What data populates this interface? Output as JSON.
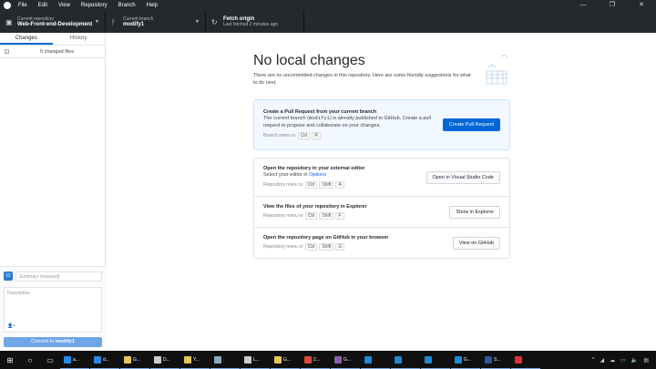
{
  "menu": [
    "File",
    "Edit",
    "View",
    "Repository",
    "Branch",
    "Help"
  ],
  "window_controls": [
    "—",
    "❐",
    "✕"
  ],
  "toolbar": {
    "repo_label": "Current repository",
    "repo": "Web-Front-end-Development",
    "branch_label": "Current branch",
    "branch": "modify1",
    "fetch": "Fetch origin",
    "fetched": "Last fetched 2 minutes ago"
  },
  "sidebar": {
    "tabs": [
      "Changes",
      "History"
    ],
    "changed": "0 changed files",
    "summary_placeholder": "Summary (required)",
    "description_placeholder": "Description",
    "commit_prefix": "Commit to ",
    "commit_branch": "modify1"
  },
  "main": {
    "title": "No local changes",
    "intro": "There are no uncommitted changes in this repository. Here are some friendly suggestions for what to do next.",
    "pr": {
      "title": "Create a Pull Request from your current branch",
      "desc_a": "The current branch (",
      "branch": "modify1",
      "desc_b": ") is already published to GitHub. Create a pull request to propose and collaborate on your changes.",
      "hint": "Branch menu or",
      "keys": [
        "Ctrl",
        "R"
      ],
      "button": "Create Pull Request"
    },
    "cards": [
      {
        "title": "Open the repository in your external editor",
        "desc": "Select your editor in ",
        "link": "Options",
        "hint": "Repository menu or",
        "keys": [
          "Ctrl",
          "Shift",
          "A"
        ],
        "button": "Open in Visual Studio Code"
      },
      {
        "title": "View the files of your repository in Explorer",
        "hint": "Repository menu or",
        "keys": [
          "Ctrl",
          "Shift",
          "F"
        ],
        "button": "Show in Explorer"
      },
      {
        "title": "Open the repository page on GitHub in your browser",
        "hint": "Repository menu or",
        "keys": [
          "Ctrl",
          "Shift",
          "G"
        ],
        "button": "View on GitHub"
      }
    ]
  },
  "taskbar": {
    "items": [
      {
        "label": "a...",
        "color": "#2b8ae6"
      },
      {
        "label": "d...",
        "color": "#2b8ae6"
      },
      {
        "label": "G...",
        "color": "#e8c25a"
      },
      {
        "label": "D...",
        "color": "#ccc"
      },
      {
        "label": "Y...",
        "color": "#e8c25a"
      },
      {
        "label": "",
        "color": "#8ab"
      },
      {
        "label": "L...",
        "color": "#ccc"
      },
      {
        "label": "G...",
        "color": "#e8c25a"
      },
      {
        "label": "2...",
        "color": "#e04a3a"
      },
      {
        "label": "G...",
        "color": "#8e5ea2"
      },
      {
        "label": "",
        "color": "#1e8ad6"
      },
      {
        "label": "",
        "color": "#1e8ad6"
      },
      {
        "label": "",
        "color": "#1e8ad6"
      },
      {
        "label": "G...",
        "color": "#1e8ad6"
      },
      {
        "label": "S...",
        "color": "#2b5797"
      },
      {
        "label": "",
        "color": "#d33"
      }
    ]
  }
}
